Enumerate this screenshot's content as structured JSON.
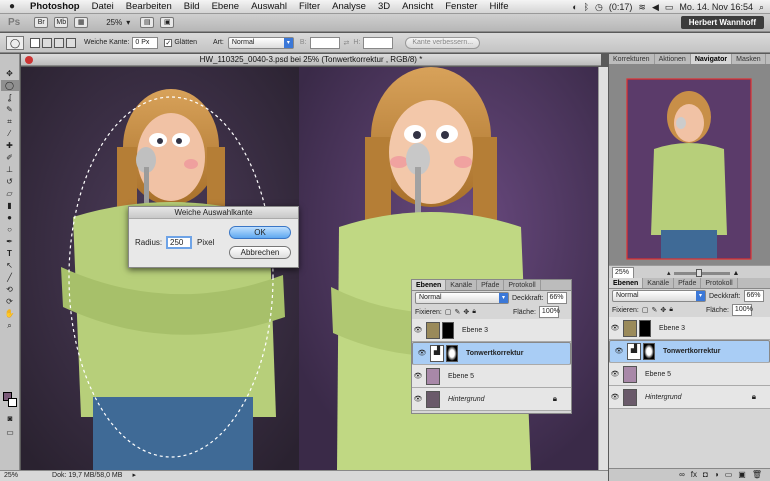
{
  "menubar": {
    "app": "Photoshop",
    "items": [
      "Datei",
      "Bearbeiten",
      "Bild",
      "Ebene",
      "Auswahl",
      "Filter",
      "Analyse",
      "3D",
      "Ansicht",
      "Fenster",
      "Hilfe"
    ],
    "battery": "(0:17)",
    "datetime": "Mo. 14. Nov 16:54"
  },
  "appbar": {
    "logo": "Ps",
    "zoom": "25%",
    "user": "Herbert Wannhoff"
  },
  "options": {
    "feather_label": "Weiche Kante:",
    "feather_value": "0 Px",
    "smooth_label": "Glätten",
    "style_label": "Art:",
    "style_value": "Normal",
    "width_label": "B:",
    "height_label": "H:",
    "refine_button": "Kante verbessern..."
  },
  "document": {
    "title": "HW_110325_0040-3.psd bei 25% (Tonwertkorrektur , RGB/8) *"
  },
  "status": {
    "zoom": "25%",
    "doc": "Dok: 19,7 MB/58,0 MB"
  },
  "dialog": {
    "title": "Weiche Auswahlkante",
    "radius_label": "Radius:",
    "radius_value": "250",
    "unit": "Pixel",
    "ok": "OK",
    "cancel": "Abbrechen"
  },
  "layers_panel": {
    "tabs": [
      "Ebenen",
      "Kanäle",
      "Pfade",
      "Protokoll"
    ],
    "blend": "Normal",
    "opacity_label": "Deckkraft:",
    "opacity": "66%",
    "lock_label": "Fixieren:",
    "fill_label": "Fläche:",
    "fill": "100%",
    "layers": [
      {
        "name": "Ebene 3",
        "selected": false
      },
      {
        "name": "Tonwertkorrektur",
        "selected": true
      },
      {
        "name": "Ebene 5",
        "selected": false
      },
      {
        "name": "Hintergrund",
        "selected": false
      }
    ]
  },
  "navigator": {
    "tabs": [
      "Korrekturen",
      "Aktionen",
      "Navigator",
      "Masken"
    ],
    "zoom": "25%"
  },
  "colors": {
    "accent": "#3b78d8",
    "selected_layer": "#a9cdf5",
    "backdrop": "#5b3b6a",
    "sweater": "#b7cf7a"
  }
}
